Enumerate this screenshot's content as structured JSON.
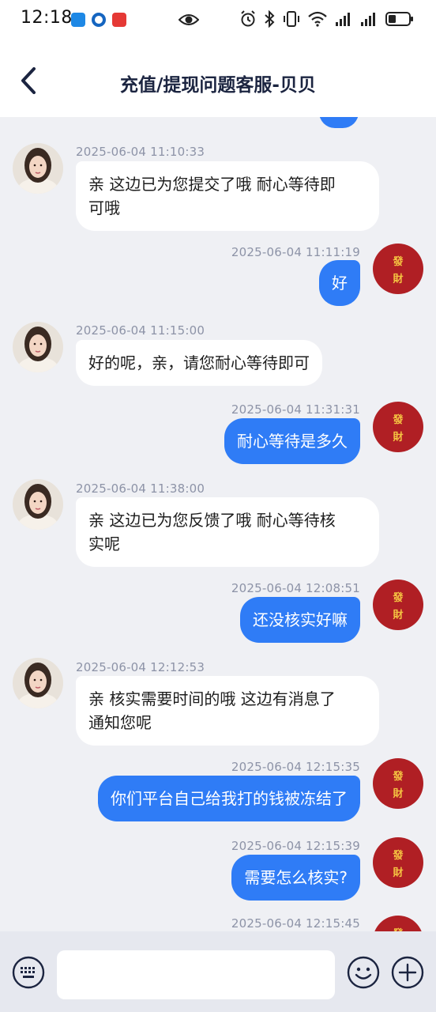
{
  "status_bar": {
    "time": "12:18",
    "apps": [
      "blue-app-icon",
      "messenger-icon",
      "red-app-icon"
    ],
    "icons": [
      "eye-icon",
      "alarm-icon",
      "bluetooth-icon",
      "vibrate-icon",
      "wifi-icon",
      "signal-icon",
      "signal-icon",
      "battery-icon"
    ]
  },
  "header": {
    "title": "充值/提现问题客服-贝贝",
    "back_icon": "chevron-left-icon"
  },
  "colors": {
    "outgoing_bubble": "#2f7cf6",
    "incoming_bubble": "#ffffff",
    "background": "#eff0f4",
    "header_title": "#1b2440",
    "avatar_red": "#b01f24"
  },
  "avatar_right_text": [
    "發",
    "財"
  ],
  "messages": [
    {
      "side": "left",
      "time": "2025-06-04 11:10:33",
      "lines": [
        "亲 这边已为您提交了哦 耐心等待即",
        "可哦"
      ]
    },
    {
      "side": "right",
      "time": "2025-06-04 11:11:19",
      "text": "好"
    },
    {
      "side": "left",
      "time": "2025-06-04 11:15:00",
      "lines": [
        "好的呢，亲，请您耐心等待即可"
      ]
    },
    {
      "side": "right",
      "time": "2025-06-04 11:31:31",
      "text": "耐心等待是多久"
    },
    {
      "side": "left",
      "time": "2025-06-04 11:38:00",
      "lines": [
        "亲 这边已为您反馈了哦 耐心等待核",
        "实呢"
      ]
    },
    {
      "side": "right",
      "time": "2025-06-04 12:08:51",
      "text": "还没核实好嘛"
    },
    {
      "side": "left",
      "time": "2025-06-04 12:12:53",
      "lines": [
        "亲 核实需要时间的哦 这边有消息了",
        "通知您呢"
      ]
    },
    {
      "side": "right",
      "time": "2025-06-04 12:15:35",
      "text": "你们平台自己给我打的钱被冻结了"
    },
    {
      "side": "right",
      "time": "2025-06-04 12:15:39",
      "text": "需要怎么核实?"
    },
    {
      "side": "right",
      "time": "2025-06-04 12:15:45",
      "text": ""
    }
  ],
  "input": {
    "value": "",
    "placeholder": ""
  },
  "bottom_icons": [
    "keyboard-icon",
    "emoji-icon",
    "plus-icon"
  ]
}
